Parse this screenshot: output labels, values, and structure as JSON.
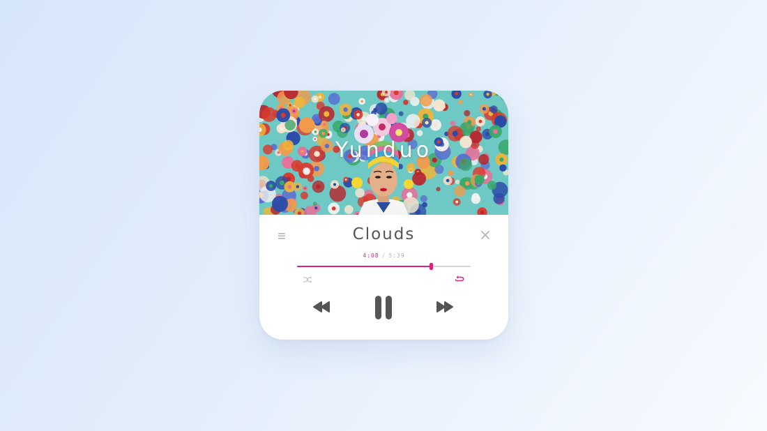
{
  "player": {
    "artist": "Yunduo",
    "title": "Clouds",
    "time": {
      "elapsed": "4:08",
      "separator": "/",
      "total": "5:39"
    },
    "progress": 0.77,
    "state": "playing",
    "repeat_active": true,
    "shuffle_active": false
  },
  "icons": {
    "menu": "menu-icon",
    "close": "close-icon",
    "shuffle": "shuffle-icon",
    "repeat": "repeat-icon",
    "rewind": "rewind-icon",
    "pause": "pause-icon",
    "forward": "fast-forward-icon"
  },
  "colors": {
    "accent": "#e0207f",
    "controls": "#555555",
    "muted": "#b5b5b5"
  }
}
